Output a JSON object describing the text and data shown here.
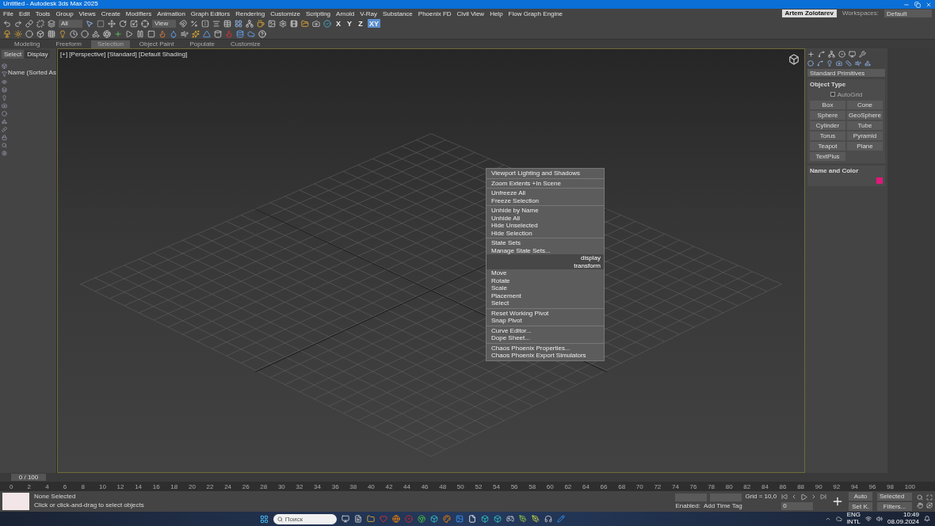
{
  "window": {
    "title": "Untitled - Autodesk 3ds Max 2025"
  },
  "menu_bar": [
    "File",
    "Edit",
    "Tools",
    "Group",
    "Views",
    "Create",
    "Modifiers",
    "Animation",
    "Graph Editors",
    "Rendering",
    "Customize",
    "Scripting",
    "Arnold",
    "V-Ray",
    "Substance",
    "Phoenix FD",
    "Civil View",
    "Help",
    "Flow Graph Engine"
  ],
  "account": {
    "user": "Artem Zolotarev",
    "workspaces_label": "Workspaces:",
    "workspace": "Default"
  },
  "toolbar": {
    "selection_filter": "All",
    "coord_system": "View",
    "axes": [
      {
        "label": "X",
        "selected": false
      },
      {
        "label": "Y",
        "selected": false
      },
      {
        "label": "Z",
        "selected": false
      },
      {
        "label": "XY",
        "selected": true
      }
    ]
  },
  "ribbon_tabs": [
    {
      "label": "Modeling",
      "selected": false
    },
    {
      "label": "Freeform",
      "selected": false
    },
    {
      "label": "Selection",
      "selected": true
    },
    {
      "label": "Object Paint",
      "selected": false
    },
    {
      "label": "Populate",
      "selected": false
    },
    {
      "label": "Customize",
      "selected": false
    }
  ],
  "scene_explorer": {
    "tabs": [
      {
        "label": "Select",
        "selected": true
      },
      {
        "label": "Display",
        "selected": false
      }
    ],
    "column_header": "Name (Sorted As"
  },
  "viewport": {
    "label": "[+] [Perspective] [Standard] [Default Shading]",
    "context_menu": [
      {
        "kind": "item",
        "label": "Viewport Lighting and Shadows"
      },
      {
        "kind": "separator"
      },
      {
        "kind": "item",
        "label": "Zoom Extents +In Scene"
      },
      {
        "kind": "separator"
      },
      {
        "kind": "item",
        "label": "Unfreeze All"
      },
      {
        "kind": "item",
        "label": "Freeze Selection"
      },
      {
        "kind": "separator"
      },
      {
        "kind": "item",
        "label": "Unhide by Name"
      },
      {
        "kind": "item",
        "label": "Unhide All"
      },
      {
        "kind": "item",
        "label": "Hide Unselected"
      },
      {
        "kind": "item",
        "label": "Hide Selection"
      },
      {
        "kind": "separator"
      },
      {
        "kind": "item",
        "label": "State Sets"
      },
      {
        "kind": "item",
        "label": "Manage State Sets..."
      },
      {
        "kind": "header",
        "label": "display"
      },
      {
        "kind": "header",
        "label": "transform"
      },
      {
        "kind": "item",
        "label": "Move"
      },
      {
        "kind": "item",
        "label": "Rotate"
      },
      {
        "kind": "item",
        "label": "Scale"
      },
      {
        "kind": "item",
        "label": "Placement"
      },
      {
        "kind": "item",
        "label": "Select"
      },
      {
        "kind": "separator"
      },
      {
        "kind": "item",
        "label": "Reset Working Pivot"
      },
      {
        "kind": "item",
        "label": "Snap Pivot"
      },
      {
        "kind": "separator"
      },
      {
        "kind": "item",
        "label": "Curve Editor..."
      },
      {
        "kind": "item",
        "label": "Dope Sheet..."
      },
      {
        "kind": "separator"
      },
      {
        "kind": "item",
        "label": "Chaos Phoenix Properties..."
      },
      {
        "kind": "item",
        "label": "Chaos Phoenix Export Simulators"
      }
    ]
  },
  "command_panel": {
    "dropdown": "Standard Primitives",
    "object_type": "Object Type",
    "autogrid": {
      "label": "AutoGrid",
      "checked": false
    },
    "buttons": [
      "Box",
      "Cone",
      "Sphere",
      "GeoSphere",
      "Cylinder",
      "Tube",
      "Torus",
      "Pyramid",
      "Teapot",
      "Plane",
      "TextPlus"
    ],
    "name_and_color": "Name and Color"
  },
  "timeline": {
    "position": "0 / 100",
    "ticks": [
      "0",
      "2",
      "4",
      "6",
      "8",
      "10",
      "12",
      "14",
      "16",
      "18",
      "20",
      "22",
      "24",
      "26",
      "28",
      "30",
      "32",
      "34",
      "36",
      "38",
      "40",
      "42",
      "44",
      "46",
      "48",
      "50",
      "52",
      "54",
      "56",
      "58",
      "60",
      "62",
      "64",
      "66",
      "68",
      "70",
      "72",
      "74",
      "76",
      "78",
      "80",
      "82",
      "84",
      "86",
      "88",
      "90",
      "92",
      "94",
      "96",
      "98",
      "100"
    ]
  },
  "status_bar": {
    "selection": "None Selected",
    "prompt": "Click or click-and-drag to select objects",
    "grid": "Grid = 10,0",
    "enabled": "Enabled:",
    "time_tag": "Add Time Tag",
    "frame": "0",
    "key_buttons": [
      "Auto",
      "Set K."
    ],
    "key_filter": "Selected",
    "filters": "Filters..."
  },
  "taskbar": {
    "search_placeholder": "Поиск",
    "language": "ENG",
    "layout": "INTL",
    "time": "10:49",
    "date": "08.09.2024"
  }
}
